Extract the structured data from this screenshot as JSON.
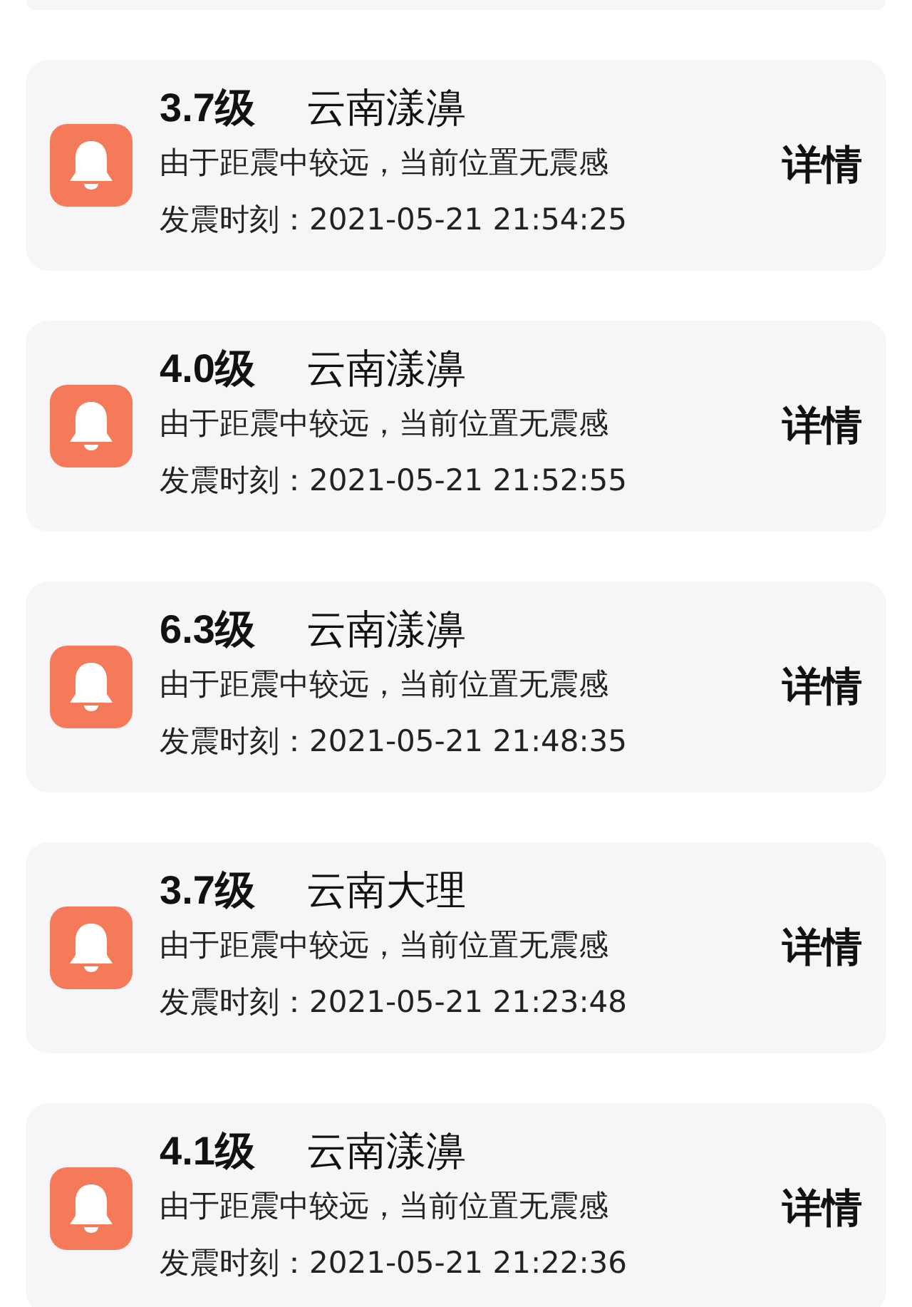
{
  "alerts": [
    {
      "magnitude": "3.7级",
      "location": "云南漾濞",
      "note": "由于距震中较远，当前位置无震感",
      "time": "发震时刻：2021-05-21 21:54:25",
      "action": "详情"
    },
    {
      "magnitude": "4.0级",
      "location": "云南漾濞",
      "note": "由于距震中较远，当前位置无震感",
      "time": "发震时刻：2021-05-21 21:52:55",
      "action": "详情"
    },
    {
      "magnitude": "6.3级",
      "location": "云南漾濞",
      "note": "由于距震中较远，当前位置无震感",
      "time": "发震时刻：2021-05-21 21:48:35",
      "action": "详情"
    },
    {
      "magnitude": "3.7级",
      "location": "云南大理",
      "note": "由于距震中较远，当前位置无震感",
      "time": "发震时刻：2021-05-21 21:23:48",
      "action": "详情"
    },
    {
      "magnitude": "4.1级",
      "location": "云南漾濞",
      "note": "由于距震中较远，当前位置无震感",
      "time": "发震时刻：2021-05-21 21:22:36",
      "action": "详情"
    }
  ]
}
